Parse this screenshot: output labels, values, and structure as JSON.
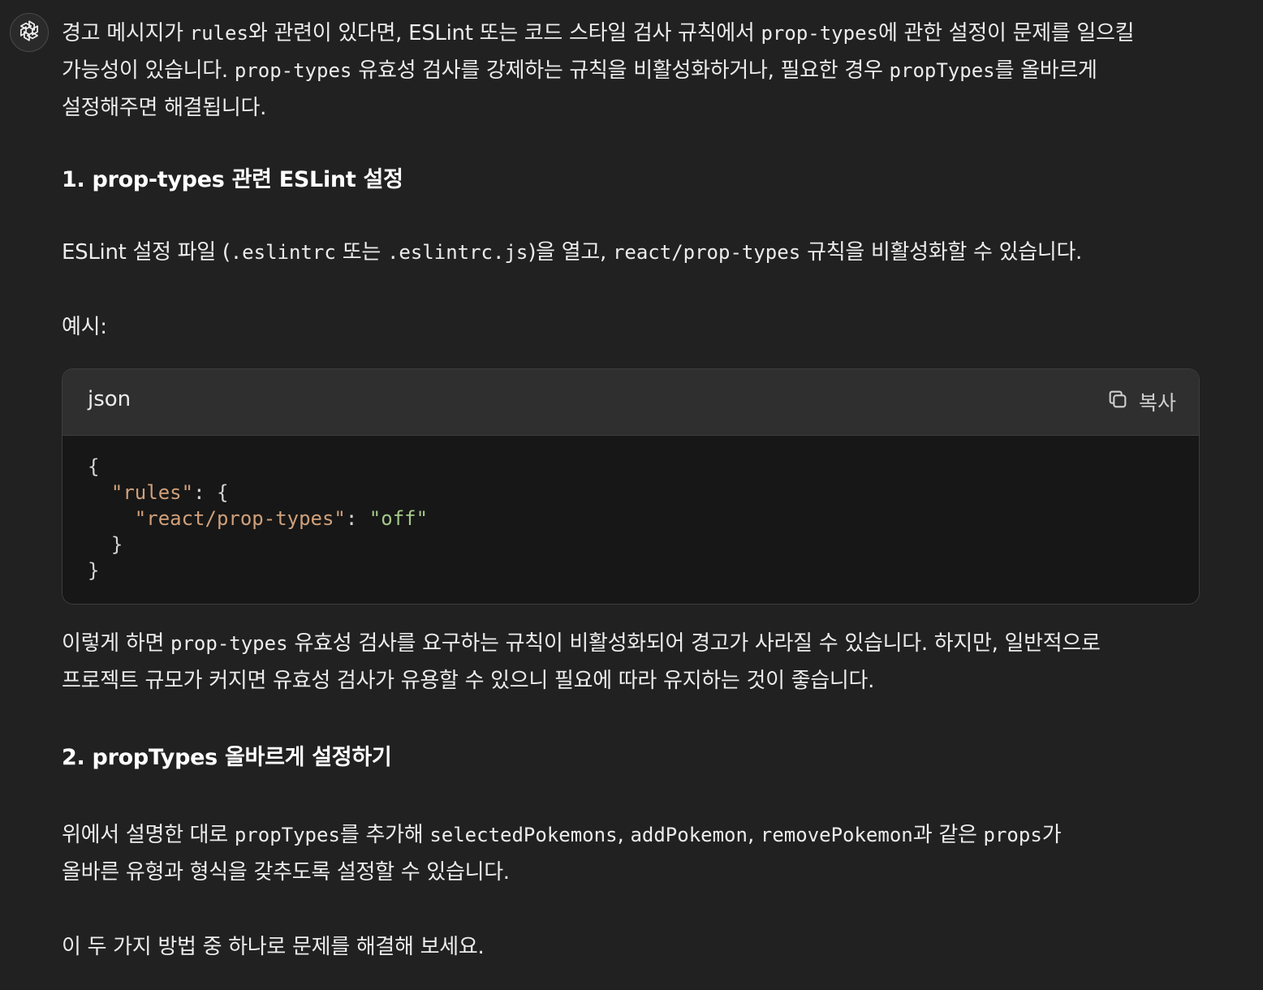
{
  "avatar": {
    "icon": "openai-logo-icon"
  },
  "intro": {
    "line1": [
      {
        "t": "text",
        "v": "경고 메시지가 "
      },
      {
        "t": "code",
        "v": "rules"
      },
      {
        "t": "text",
        "v": "와 관련이 있다면, ESLint 또는 코드 스타일 검사 규칙에서 "
      },
      {
        "t": "code",
        "v": "prop-types"
      },
      {
        "t": "text",
        "v": "에 관한 설정이 문제를 일으킬"
      }
    ],
    "line2": [
      {
        "t": "text",
        "v": "가능성이 있습니다. "
      },
      {
        "t": "code",
        "v": "prop-types"
      },
      {
        "t": "text",
        "v": " 유효성 검사를 강제하는 규칙을 비활성화하거나, 필요한 경우 "
      },
      {
        "t": "code",
        "v": "propTypes"
      },
      {
        "t": "text",
        "v": "를 올바르게"
      }
    ],
    "line3": [
      {
        "t": "text",
        "v": "설정해주면 해결됩니다."
      }
    ]
  },
  "section1": {
    "heading": "1. prop-types 관련 ESLint 설정",
    "body": [
      {
        "t": "text",
        "v": "ESLint 설정 파일 ("
      },
      {
        "t": "code",
        "v": ".eslintrc"
      },
      {
        "t": "text",
        "v": " 또는 "
      },
      {
        "t": "code",
        "v": ".eslintrc.js"
      },
      {
        "t": "text",
        "v": ")을 열고, "
      },
      {
        "t": "code",
        "v": "react/prop-types"
      },
      {
        "t": "text",
        "v": " 규칙을 비활성화할 수 있습니다."
      }
    ],
    "example_label": "예시:"
  },
  "codeblock": {
    "language": "json",
    "copy_label": "복사",
    "copy_icon": "copy-icon",
    "lines": [
      [
        {
          "c": "punct",
          "v": "{"
        }
      ],
      [
        {
          "c": "punct",
          "v": "  "
        },
        {
          "c": "key",
          "v": "\"rules\""
        },
        {
          "c": "punct",
          "v": ": {"
        }
      ],
      [
        {
          "c": "punct",
          "v": "    "
        },
        {
          "c": "key",
          "v": "\"react/prop-types\""
        },
        {
          "c": "punct",
          "v": ": "
        },
        {
          "c": "str",
          "v": "\"off\""
        }
      ],
      [
        {
          "c": "punct",
          "v": "  }"
        }
      ],
      [
        {
          "c": "punct",
          "v": "}"
        }
      ]
    ],
    "colors": {
      "key": "#d0a07a",
      "string": "#a5c88a",
      "punct": "#d4d4d4"
    }
  },
  "after_code": {
    "line1": [
      {
        "t": "text",
        "v": "이렇게 하면 "
      },
      {
        "t": "code",
        "v": "prop-types"
      },
      {
        "t": "text",
        "v": " 유효성 검사를 요구하는 규칙이 비활성화되어 경고가 사라질 수 있습니다. 하지만, 일반적으로"
      }
    ],
    "line2": [
      {
        "t": "text",
        "v": "프로젝트 규모가 커지면 유효성 검사가 유용할 수 있으니 필요에 따라 유지하는 것이 좋습니다."
      }
    ]
  },
  "section2": {
    "heading": "2. propTypes 올바르게 설정하기",
    "line1": [
      {
        "t": "text",
        "v": "위에서 설명한 대로 "
      },
      {
        "t": "code",
        "v": "propTypes"
      },
      {
        "t": "text",
        "v": "를 추가해 "
      },
      {
        "t": "code",
        "v": "selectedPokemons"
      },
      {
        "t": "text",
        "v": ", "
      },
      {
        "t": "code",
        "v": "addPokemon"
      },
      {
        "t": "text",
        "v": ", "
      },
      {
        "t": "code",
        "v": "removePokemon"
      },
      {
        "t": "text",
        "v": "과 같은 "
      },
      {
        "t": "code",
        "v": "props"
      },
      {
        "t": "text",
        "v": "가"
      }
    ],
    "line2": [
      {
        "t": "text",
        "v": "올바른 유형과 형식을 갖추도록 설정할 수 있습니다."
      }
    ]
  },
  "closing": "이 두 가지 방법 중 하나로 문제를 해결해 보세요.",
  "theme": {
    "background": "#212121",
    "text": "#ececec",
    "code_bg": "#171717",
    "code_header_bg": "#2f2f2f"
  }
}
